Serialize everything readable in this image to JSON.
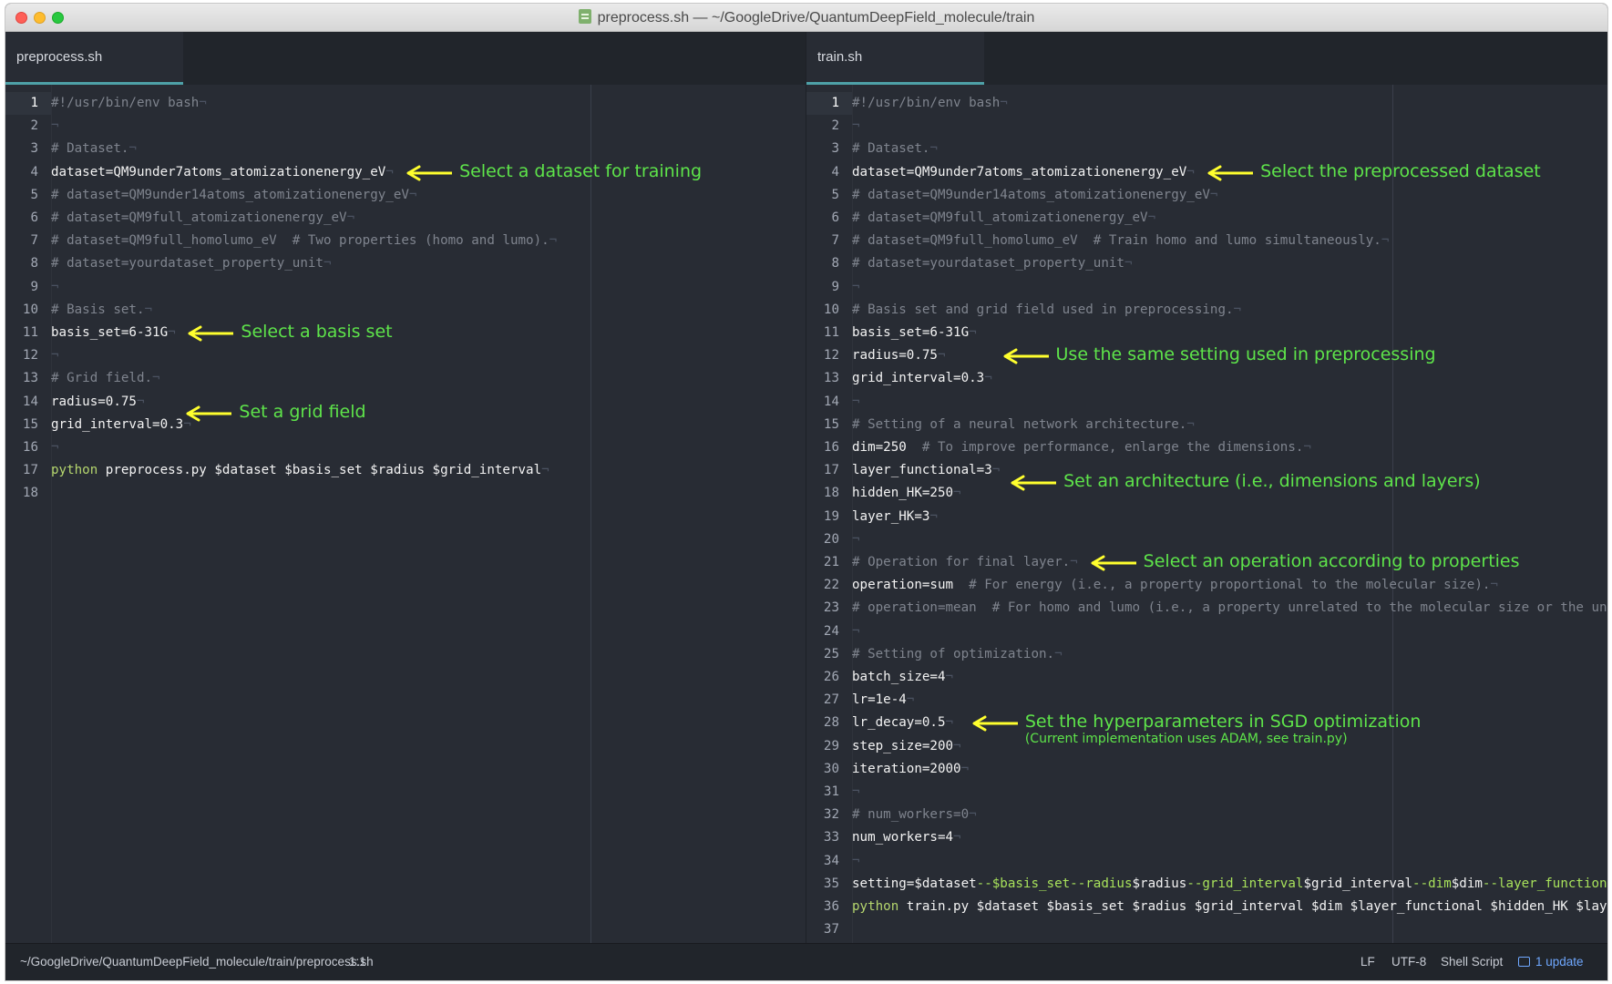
{
  "window": {
    "title": "preprocess.sh — ~/GoogleDrive/QuantumDeepField_molecule/train"
  },
  "left_pane": {
    "tab_label": "preprocess.sh",
    "lines": [
      {
        "n": "1",
        "text": "#!/usr/bin/env bash",
        "kind": "comment"
      },
      {
        "n": "2",
        "text": "",
        "kind": "blank"
      },
      {
        "n": "3",
        "text": "# Dataset.",
        "kind": "comment"
      },
      {
        "n": "4",
        "text": "dataset=QM9under7atoms_atomizationenergy_eV",
        "kind": "plain"
      },
      {
        "n": "5",
        "text": "# dataset=QM9under14atoms_atomizationenergy_eV",
        "kind": "comment"
      },
      {
        "n": "6",
        "text": "# dataset=QM9full_atomizationenergy_eV",
        "kind": "comment"
      },
      {
        "n": "7",
        "text": "# dataset=QM9full_homolumo_eV  # Two properties (homo and lumo).",
        "kind": "comment"
      },
      {
        "n": "8",
        "text": "# dataset=yourdataset_property_unit",
        "kind": "comment"
      },
      {
        "n": "9",
        "text": "",
        "kind": "blank"
      },
      {
        "n": "10",
        "text": "# Basis set.",
        "kind": "comment"
      },
      {
        "n": "11",
        "text": "basis_set=6-31G",
        "kind": "plain"
      },
      {
        "n": "12",
        "text": "",
        "kind": "blank"
      },
      {
        "n": "13",
        "text": "# Grid field.",
        "kind": "comment"
      },
      {
        "n": "14",
        "text": "radius=0.75",
        "kind": "plain"
      },
      {
        "n": "15",
        "text": "grid_interval=0.3",
        "kind": "plain"
      },
      {
        "n": "16",
        "text": "",
        "kind": "blank"
      },
      {
        "n": "17",
        "keyword": "python",
        "text": " preprocess.py $dataset $basis_set $radius $grid_interval",
        "kind": "command"
      },
      {
        "n": "18",
        "text": "",
        "kind": "last"
      }
    ],
    "annotations": [
      {
        "text": "Select a dataset for training",
        "line": 4
      },
      {
        "text": "Select a basis set",
        "line": 11
      },
      {
        "text": "Set a grid field",
        "line": 14.5
      }
    ]
  },
  "right_pane": {
    "tab_label": "train.sh",
    "lines": [
      {
        "n": "1",
        "text": "#!/usr/bin/env bash",
        "kind": "comment"
      },
      {
        "n": "2",
        "text": "",
        "kind": "blank"
      },
      {
        "n": "3",
        "text": "# Dataset.",
        "kind": "comment"
      },
      {
        "n": "4",
        "text": "dataset=QM9under7atoms_atomizationenergy_eV",
        "kind": "plain"
      },
      {
        "n": "5",
        "text": "# dataset=QM9under14atoms_atomizationenergy_eV",
        "kind": "comment"
      },
      {
        "n": "6",
        "text": "# dataset=QM9full_atomizationenergy_eV",
        "kind": "comment"
      },
      {
        "n": "7",
        "text": "# dataset=QM9full_homolumo_eV  # Train homo and lumo simultaneously.",
        "kind": "comment"
      },
      {
        "n": "8",
        "text": "# dataset=yourdataset_property_unit",
        "kind": "comment"
      },
      {
        "n": "9",
        "text": "",
        "kind": "blank"
      },
      {
        "n": "10",
        "text": "# Basis set and grid field used in preprocessing.",
        "kind": "comment"
      },
      {
        "n": "11",
        "text": "basis_set=6-31G",
        "kind": "plain"
      },
      {
        "n": "12",
        "text": "radius=0.75",
        "kind": "plain"
      },
      {
        "n": "13",
        "text": "grid_interval=0.3",
        "kind": "plain"
      },
      {
        "n": "14",
        "text": "",
        "kind": "blank"
      },
      {
        "n": "15",
        "text": "# Setting of a neural network architecture.",
        "kind": "comment"
      },
      {
        "n": "16",
        "text": "dim=250",
        "comment": "  # To improve performance, enlarge the dimensions.",
        "kind": "plain_comment"
      },
      {
        "n": "17",
        "text": "layer_functional=3",
        "kind": "plain"
      },
      {
        "n": "18",
        "text": "hidden_HK=250",
        "kind": "plain"
      },
      {
        "n": "19",
        "text": "layer_HK=3",
        "kind": "plain"
      },
      {
        "n": "20",
        "text": "",
        "kind": "blank"
      },
      {
        "n": "21",
        "text": "# Operation for final layer.",
        "kind": "comment"
      },
      {
        "n": "22",
        "text": "operation=sum",
        "comment": "  # For energy (i.e., a property proportional to the molecular size).",
        "kind": "plain_comment"
      },
      {
        "n": "23",
        "text": "# operation=mean  # For homo and lumo (i.e., a property unrelated to the molecular size or the un",
        "kind": "comment_noeol"
      },
      {
        "n": "24",
        "text": "",
        "kind": "blank"
      },
      {
        "n": "25",
        "text": "# Setting of optimization.",
        "kind": "comment"
      },
      {
        "n": "26",
        "text": "batch_size=4",
        "kind": "plain"
      },
      {
        "n": "27",
        "text": "lr=1e-4",
        "kind": "plain"
      },
      {
        "n": "28",
        "text": "lr_decay=0.5",
        "kind": "plain"
      },
      {
        "n": "29",
        "text": "step_size=200",
        "kind": "plain"
      },
      {
        "n": "30",
        "text": "iteration=2000",
        "kind": "plain"
      },
      {
        "n": "31",
        "text": "",
        "kind": "blank"
      },
      {
        "n": "32",
        "text": "# num_workers=0",
        "kind": "comment"
      },
      {
        "n": "33",
        "text": "num_workers=4",
        "kind": "plain"
      },
      {
        "n": "34",
        "text": "",
        "kind": "blank"
      },
      {
        "n": "35",
        "kind": "setting",
        "segments": [
          {
            "t": "setting=$dataset",
            "c": "plain"
          },
          {
            "t": "--$",
            "c": "sym"
          },
          {
            "t": "basis_set",
            "c": "sym"
          },
          {
            "t": "--radius",
            "c": "sym"
          },
          {
            "t": "$radius",
            "c": "plain"
          },
          {
            "t": "--grid_interval",
            "c": "sym"
          },
          {
            "t": "$grid_interval",
            "c": "plain"
          },
          {
            "t": "--dim",
            "c": "sym"
          },
          {
            "t": "$dim",
            "c": "plain"
          },
          {
            "t": "--layer_function",
            "c": "sym"
          }
        ]
      },
      {
        "n": "36",
        "keyword": "python",
        "text": " train.py $dataset $basis_set $radius $grid_interval $dim $layer_functional $hidden_HK $lay",
        "kind": "command_noeol"
      },
      {
        "n": "37",
        "text": "",
        "kind": "last"
      }
    ],
    "annotations": [
      {
        "text": "Select the preprocessed dataset",
        "line": 4
      },
      {
        "text": "Use the same setting used in preprocessing",
        "line": 12
      },
      {
        "text": "Set an architecture (i.e., dimensions and layers)",
        "line": 17.5
      },
      {
        "text": "Select an operation according to properties",
        "line": 21
      },
      {
        "text": "Set the hyperparameters in SGD optimization",
        "line": 28,
        "sub": "(Current implementation uses ADAM, see train.py)"
      }
    ]
  },
  "status_bar": {
    "path": "~/GoogleDrive/QuantumDeepField_molecule/train/preprocess.sh",
    "cursor": "1:1",
    "line_ending": "LF",
    "encoding": "UTF-8",
    "grammar": "Shell Script",
    "updates": "1 update"
  }
}
